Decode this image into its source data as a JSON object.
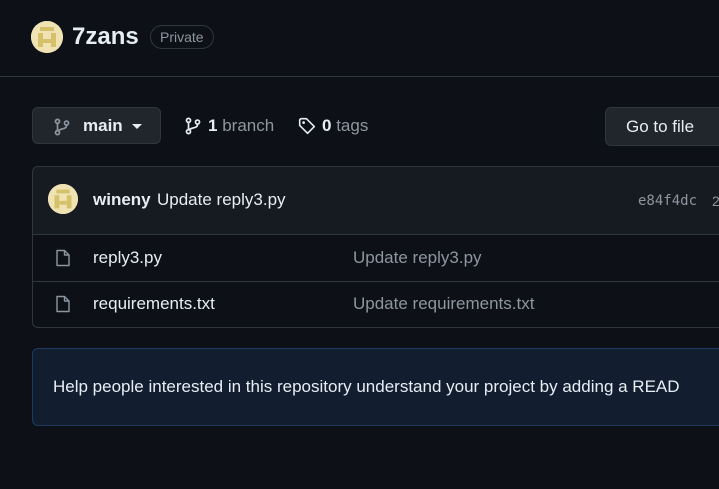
{
  "repo": {
    "name": "7zans",
    "visibility": "Private"
  },
  "toolbar": {
    "branch_name": "main",
    "branch_count": "1",
    "branch_label": "branch",
    "tag_count": "0",
    "tag_label": "tags",
    "go_to_file": "Go to file"
  },
  "latest_commit": {
    "author": "wineny",
    "message": "Update reply3.py",
    "hash": "e84f4dc",
    "extra": "2"
  },
  "files": [
    {
      "name": "reply3.py",
      "commit_message": "Update reply3.py",
      "icon": "file-icon"
    },
    {
      "name": "requirements.txt",
      "commit_message": "Update requirements.txt",
      "icon": "file-icon"
    }
  ],
  "readme_banner": {
    "text": "Help people interested in this repository understand your project by adding a READ"
  },
  "colors": {
    "background": "#0d1117",
    "border": "#30363d",
    "text_primary": "#e6edf3",
    "text_muted": "#8d96a0",
    "banner_bg": "#121d2f"
  }
}
